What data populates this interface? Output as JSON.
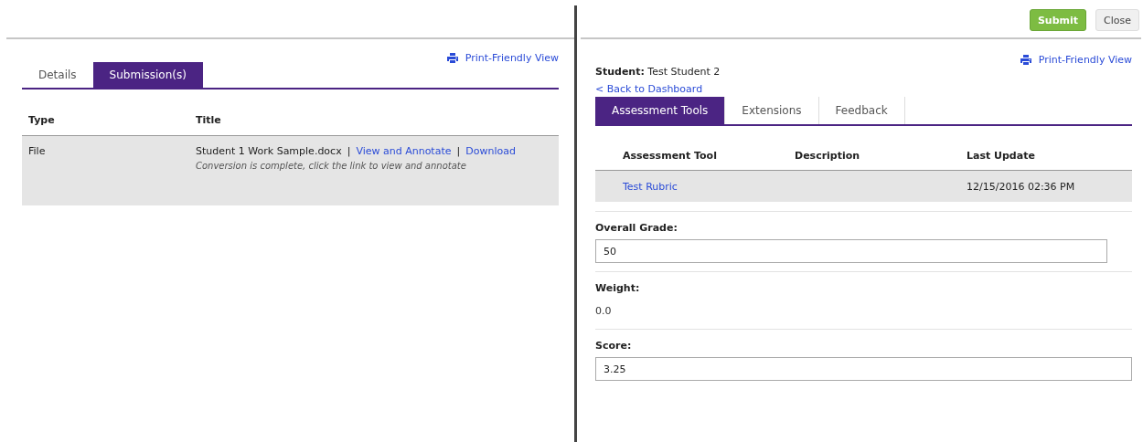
{
  "left_pane": {
    "print_link": "Print-Friendly View",
    "tabs": [
      {
        "label": "Details",
        "selected": false
      },
      {
        "label": "Submission(s)",
        "selected": true
      }
    ],
    "table": {
      "columns": [
        "Type",
        "Title"
      ],
      "rows": [
        {
          "type": "File",
          "file_name": "Student 1 Work Sample.docx",
          "separator_1": "|",
          "view_link": "View and Annotate",
          "separator_2": "|",
          "download_link": "Download",
          "note": "Conversion is complete, click the link to view and annotate"
        }
      ]
    }
  },
  "right_pane": {
    "buttons": [
      {
        "label": "Submit",
        "kind": "primary"
      },
      {
        "label": "Close",
        "kind": "default"
      }
    ],
    "print_link": "Print-Friendly View",
    "student": {
      "label": "Student:",
      "value": "Test Student 2"
    },
    "back_link": "< Back to Dashboard",
    "tabs": [
      {
        "label": "Assessment Tools",
        "selected": true
      },
      {
        "label": "Extensions",
        "selected": false
      },
      {
        "label": "Feedback",
        "selected": false
      }
    ],
    "table": {
      "columns": [
        "Assessment Tool",
        "Description",
        "Last Update"
      ],
      "rows": [
        {
          "tool": "Test Rubric",
          "description_text": "",
          "last_update": "12/15/2016 02:36 PM"
        }
      ]
    },
    "fields": [
      {
        "label": "Overall Grade:",
        "kind": "input",
        "value": "50",
        "wide": false
      },
      {
        "label": "Weight:",
        "kind": "text",
        "value": "0.0"
      },
      {
        "label": "Score:",
        "kind": "input",
        "value": "3.25",
        "wide": true
      }
    ]
  }
}
